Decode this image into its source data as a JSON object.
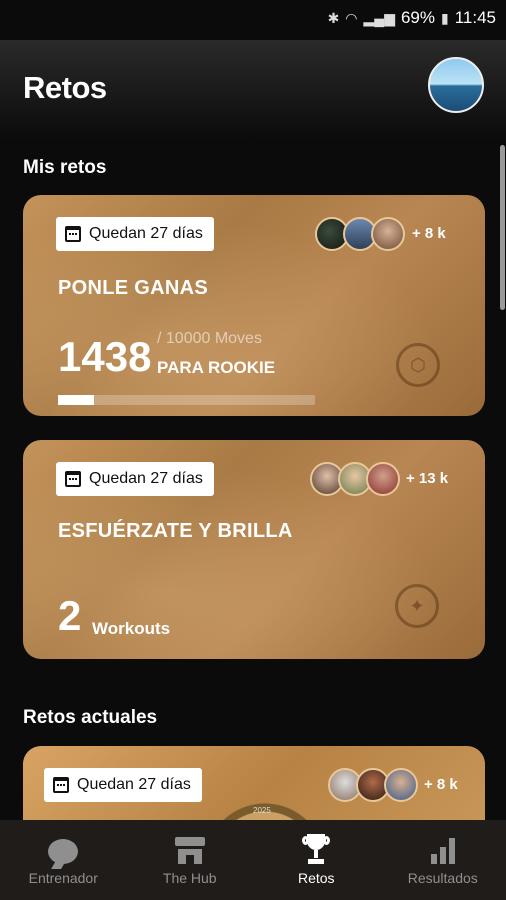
{
  "status": {
    "battery": "69%",
    "time": "11:45",
    "icons": [
      "bluetooth-icon",
      "wifi-icon",
      "signal-icon",
      "battery-icon"
    ]
  },
  "header": {
    "title": "Retos"
  },
  "sections": {
    "mine": "Mis retos",
    "current": "Retos actuales"
  },
  "cards": [
    {
      "days": "Quedan 27 días",
      "participants": "+ 8 k",
      "title": "PONLE GANAS",
      "value": "1438",
      "target": "/ 10000 Moves",
      "rank": "PARA ROOKIE",
      "progress": 0.14
    },
    {
      "days": "Quedan 27 días",
      "participants": "+ 13 k",
      "title": "ESFUÉRZATE Y BRILLA",
      "value": "2",
      "unit": "Workouts"
    },
    {
      "days": "Quedan 27 días",
      "participants": "+ 8 k",
      "watch_year": "2025"
    }
  ],
  "nav": [
    {
      "label": "Entrenador",
      "icon": "chat-bubble-icon",
      "active": false
    },
    {
      "label": "The Hub",
      "icon": "store-icon",
      "active": false
    },
    {
      "label": "Retos",
      "icon": "trophy-icon",
      "active": true
    },
    {
      "label": "Resultados",
      "icon": "bar-chart-icon",
      "active": false
    }
  ],
  "colors": {
    "card_gold": "#b88652",
    "background": "#0b0b0b",
    "nav_bg": "#1f1c1a",
    "inactive": "#8f8f8f"
  }
}
